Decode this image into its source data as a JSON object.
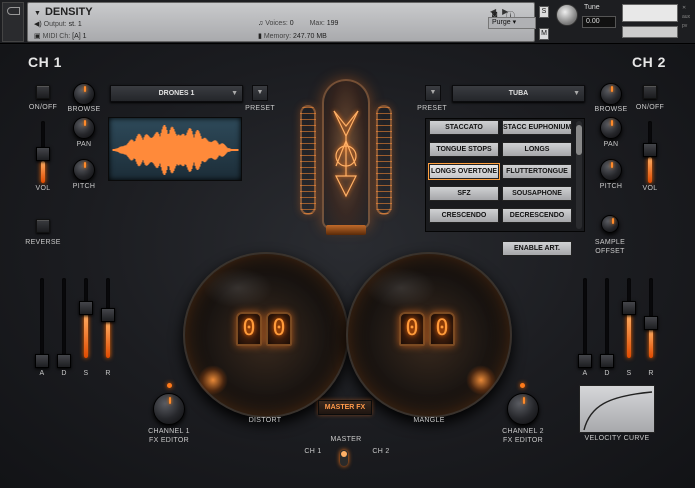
{
  "header": {
    "instrument_name": "DENSITY",
    "output_label": "Output:",
    "output_value": "st. 1",
    "midi_label": "MIDI Ch:",
    "midi_value": "[A] 1",
    "voices_label": "Voices:",
    "voices_value": "0",
    "max_label": "Max:",
    "max_value": "199",
    "memory_label": "Memory:",
    "memory_value": "247.70 MB",
    "purge_label": "Purge",
    "tune_label": "Tune",
    "tune_value": "0.00",
    "solo_label": "S",
    "mute_label": "M"
  },
  "ch1": {
    "title": "CH 1",
    "onoff_label": "ON/OFF",
    "browse_label": "BROWSE",
    "pan_label": "PAN",
    "pitch_label": "PITCH",
    "vol_label": "VOL",
    "reverse_label": "REVERSE",
    "preset_name": "DRONES 1",
    "preset_label": "PRESET",
    "fx_editor_label": "CHANNEL 1\nFX EDITOR",
    "adsr_labels": [
      "A",
      "D",
      "S",
      "R"
    ],
    "adsr_levels": [
      0.0,
      0.0,
      0.72,
      0.62
    ],
    "vol_level": 0.45
  },
  "ch2": {
    "title": "CH 2",
    "onoff_label": "ON/OFF",
    "browse_label": "BROWSE",
    "pan_label": "PAN",
    "pitch_label": "PITCH",
    "vol_label": "VOL",
    "preset_name": "TUBA",
    "preset_label": "PRESET",
    "sample_offset_label": "SAMPLE\nOFFSET",
    "fx_editor_label": "CHANNEL 2\nFX EDITOR",
    "adsr_labels": [
      "A",
      "D",
      "S",
      "R"
    ],
    "adsr_levels": [
      0.0,
      0.0,
      0.72,
      0.52
    ],
    "vol_level": 0.55
  },
  "articulations": {
    "items": [
      "STACCATO",
      "STACC EUPHONIUM",
      "TONGUE STOPS",
      "LONGS",
      "LONGS OVERTONE",
      "FLUTTERTONGUE",
      "SFZ",
      "SOUSAPHONE",
      "CRESCENDO",
      "DECRESCENDO"
    ],
    "selected": "LONGS OVERTONE",
    "enable_label": "ENABLE ART."
  },
  "fx": {
    "distort_label": "DISTORT",
    "mangle_label": "MANGLE",
    "distort_digits": [
      "0",
      "0"
    ],
    "mangle_digits": [
      "0",
      "0"
    ],
    "master_fx_label": "MASTER FX",
    "master_label": "MASTER",
    "ch1_label": "CH 1",
    "ch2_label": "CH 2"
  },
  "velocity_curve_label": "VELOCITY CURVE",
  "colors": {
    "accent": "#ff7a1a",
    "panel": "#1b1c20"
  }
}
